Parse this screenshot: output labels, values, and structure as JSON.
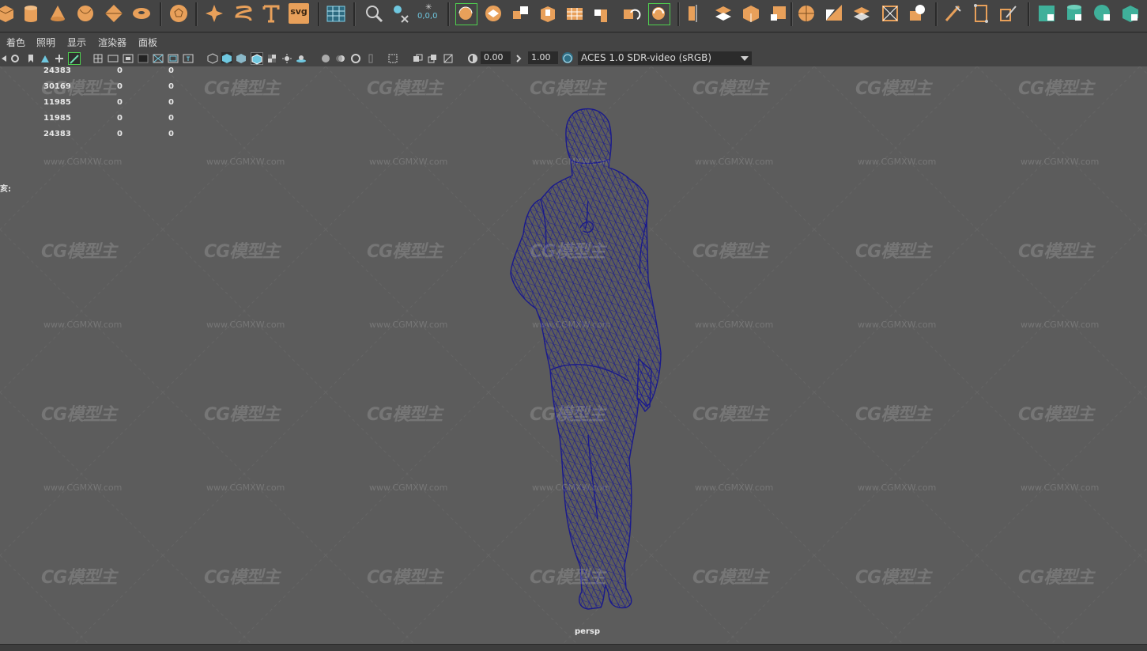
{
  "shelf": {
    "icons": [
      "cube-icon",
      "cylinder-icon",
      "cone-icon",
      "sphere-poly-icon",
      "diamond-icon",
      "torus-icon",
      "soccer-ball-icon",
      "star-icon",
      "helix-icon",
      "text-type-icon",
      "svg-icon",
      "grid-select-icon",
      "magnifier-icon",
      "snap-icon",
      "snap-coordinates-icon",
      "sculpt-icon",
      "bevel-icon",
      "combine-icon",
      "extrude-icon",
      "bridge-icon",
      "fill-hole-icon",
      "boolean-icon",
      "smooth-icon",
      "mirror-icon",
      "multi-cut-icon",
      "target-weld-icon",
      "edge-loop-icon",
      "poly-select-icon",
      "uv-icon",
      "crease-icon",
      "pen-icon",
      "measure-icon",
      "brush-icon",
      "teal-cube-icon",
      "teal-cylinder-icon",
      "teal-sphere-icon",
      "teal-cube2-icon"
    ],
    "svg_label": "svg",
    "coords_label": "0,0,0"
  },
  "menu": {
    "items": [
      "着色",
      "照明",
      "显示",
      "渲染器",
      "面板"
    ]
  },
  "viewport_toolbar": {
    "exposure_value": "0.00",
    "gamma_value": "1.00",
    "colorspace": "ACES 1.0 SDR-video (sRGB)"
  },
  "hud": {
    "rows": [
      {
        "label": "",
        "a": "24383",
        "b": "0",
        "c": "0"
      },
      {
        "label": "",
        "a": "30169",
        "b": "0",
        "c": "0"
      },
      {
        "label": "",
        "a": "11985",
        "b": "0",
        "c": "0"
      },
      {
        "label": "亥:",
        "a": "11985",
        "b": "0",
        "c": "0"
      },
      {
        "label": "",
        "a": "24383",
        "b": "0",
        "c": "0"
      }
    ]
  },
  "camera_label": "persp",
  "watermark": {
    "logo": "CG模型主",
    "url": "www.CGMXW.com"
  },
  "colors": {
    "accent_orange": "#e8a05a",
    "accent_teal": "#3fb09a",
    "wire_blue": "#1a1a8c",
    "highlight_green": "#4fd04f"
  }
}
